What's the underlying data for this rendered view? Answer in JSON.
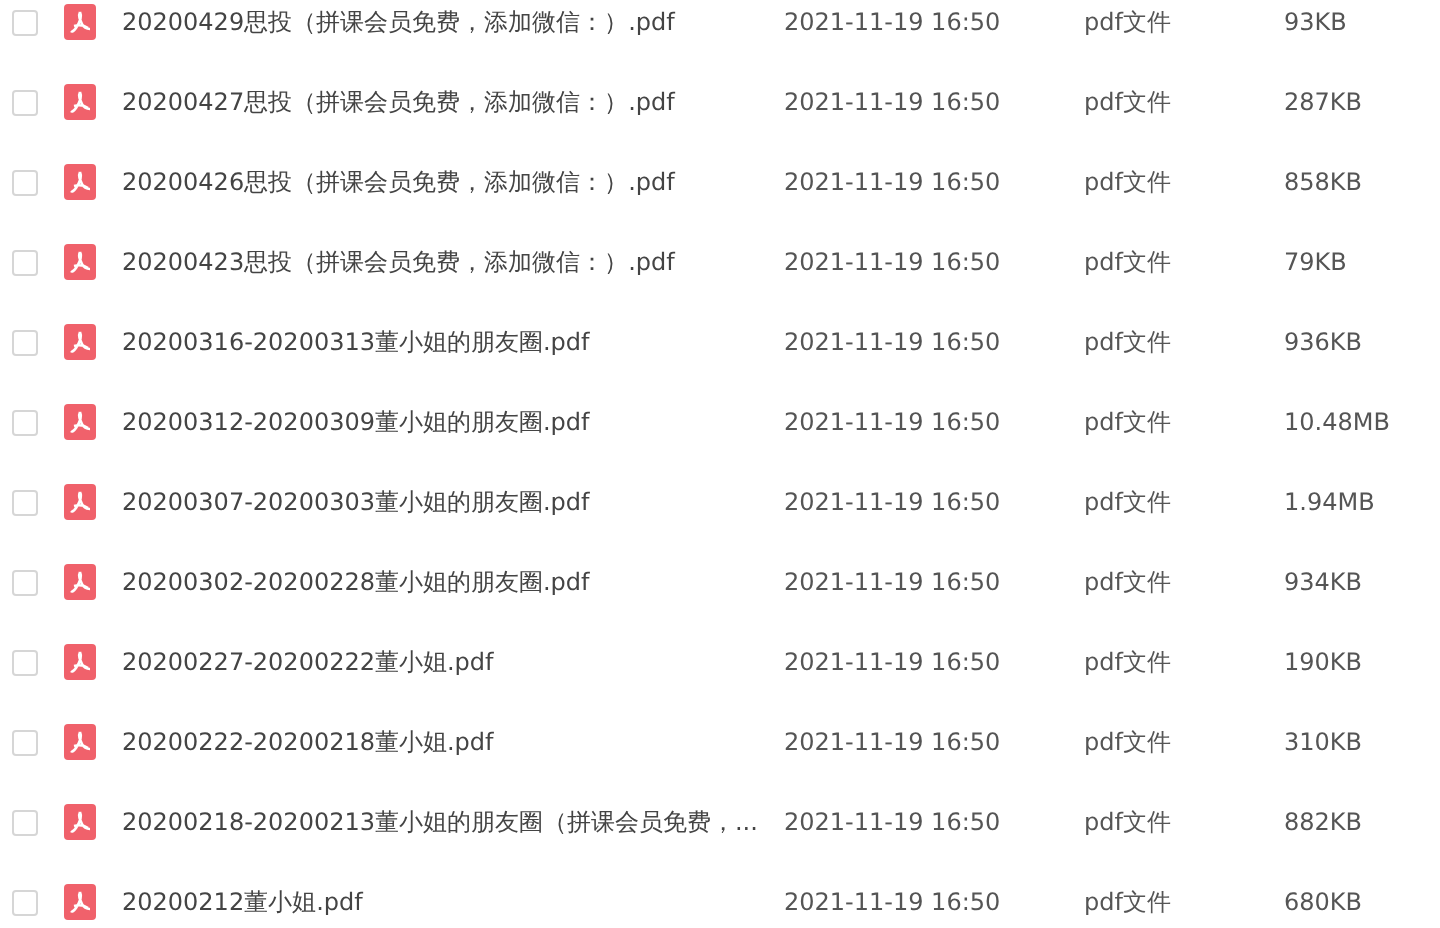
{
  "files": [
    {
      "checked": false,
      "name": "20200429思投（拼课会员免费，添加微信：）.pdf",
      "modified": "2021-11-19 16:50",
      "type": "pdf文件",
      "size": "93KB"
    },
    {
      "checked": false,
      "name": "20200427思投（拼课会员免费，添加微信：）.pdf",
      "modified": "2021-11-19 16:50",
      "type": "pdf文件",
      "size": "287KB"
    },
    {
      "checked": false,
      "name": "20200426思投（拼课会员免费，添加微信：）.pdf",
      "modified": "2021-11-19 16:50",
      "type": "pdf文件",
      "size": "858KB"
    },
    {
      "checked": false,
      "name": "20200423思投（拼课会员免费，添加微信：）.pdf",
      "modified": "2021-11-19 16:50",
      "type": "pdf文件",
      "size": "79KB"
    },
    {
      "checked": false,
      "name": "20200316-20200313董小姐的朋友圈.pdf",
      "modified": "2021-11-19 16:50",
      "type": "pdf文件",
      "size": "936KB"
    },
    {
      "checked": false,
      "name": "20200312-20200309董小姐的朋友圈.pdf",
      "modified": "2021-11-19 16:50",
      "type": "pdf文件",
      "size": "10.48MB"
    },
    {
      "checked": false,
      "name": "20200307-20200303董小姐的朋友圈.pdf",
      "modified": "2021-11-19 16:50",
      "type": "pdf文件",
      "size": "1.94MB"
    },
    {
      "checked": false,
      "name": "20200302-20200228董小姐的朋友圈.pdf",
      "modified": "2021-11-19 16:50",
      "type": "pdf文件",
      "size": "934KB"
    },
    {
      "checked": false,
      "name": "20200227-20200222董小姐.pdf",
      "modified": "2021-11-19 16:50",
      "type": "pdf文件",
      "size": "190KB"
    },
    {
      "checked": false,
      "name": "20200222-20200218董小姐.pdf",
      "modified": "2021-11-19 16:50",
      "type": "pdf文件",
      "size": "310KB"
    },
    {
      "checked": false,
      "name": "20200218-20200213董小姐的朋友圈（拼课会员免费，...",
      "modified": "2021-11-19 16:50",
      "type": "pdf文件",
      "size": "882KB"
    },
    {
      "checked": false,
      "name": "20200212董小姐.pdf",
      "modified": "2021-11-19 16:50",
      "type": "pdf文件",
      "size": "680KB"
    }
  ]
}
